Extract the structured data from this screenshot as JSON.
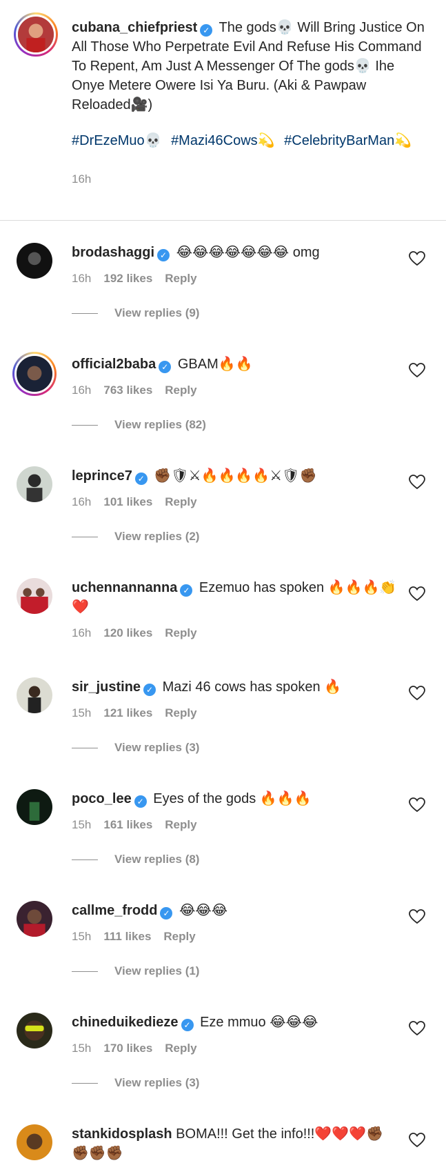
{
  "post": {
    "username": "cubana_chiefpriest",
    "caption": "The gods💀 Will Bring Justice On All Those Who Perpetrate Evil And Refuse His Command To Repent, Am Just A Messenger Of The gods💀 Ihe Onye Metere Owere Isi Ya Buru. (Aki & Pawpaw Reloaded🎥)",
    "hashtags": [
      "#DrEzeMuo💀",
      "#Mazi46Cows💫",
      "#CelebrityBarMan💫"
    ],
    "time": "16h"
  },
  "comments": [
    {
      "username": "brodashaggi",
      "text": "😂😂😂😂😂😂😂 omg",
      "time": "16h",
      "likes": "192 likes",
      "reply": "Reply",
      "view_replies": "View replies (9)"
    },
    {
      "username": "official2baba",
      "text": "GBAM🔥🔥",
      "time": "16h",
      "likes": "763 likes",
      "reply": "Reply",
      "view_replies": "View replies (82)"
    },
    {
      "username": "leprince7",
      "text": "✊🏾🛡⚔🔥🔥🔥🔥⚔🛡✊🏾",
      "time": "16h",
      "likes": "101 likes",
      "reply": "Reply",
      "view_replies": "View replies (2)"
    },
    {
      "username": "uchennannanna",
      "text": "Ezemuo has spoken 🔥🔥🔥👏❤️",
      "time": "16h",
      "likes": "120 likes",
      "reply": "Reply",
      "view_replies": ""
    },
    {
      "username": "sir_justine",
      "text": "Mazi 46 cows has spoken 🔥",
      "time": "15h",
      "likes": "121 likes",
      "reply": "Reply",
      "view_replies": "View replies (3)"
    },
    {
      "username": "poco_lee",
      "text": "Eyes of the gods 🔥🔥🔥",
      "time": "15h",
      "likes": "161 likes",
      "reply": "Reply",
      "view_replies": "View replies (8)"
    },
    {
      "username": "callme_frodd",
      "text": "😂😂😂",
      "time": "15h",
      "likes": "111 likes",
      "reply": "Reply",
      "view_replies": "View replies (1)"
    },
    {
      "username": "chineduikedieze",
      "text": "Eze mmuo 😂😂😂",
      "time": "15h",
      "likes": "170 likes",
      "reply": "Reply",
      "view_replies": "View replies (3)"
    },
    {
      "username": "stankidosplash",
      "text": "BOMA!!! Get the info!!!❤️❤️❤️✊🏾✊🏾✊🏾✊🏾",
      "time": "",
      "likes": "",
      "reply": "",
      "view_replies": ""
    }
  ],
  "colors": {
    "verified": "#3897f0",
    "hashtag": "#00376b",
    "meta": "#8e8e8e"
  }
}
